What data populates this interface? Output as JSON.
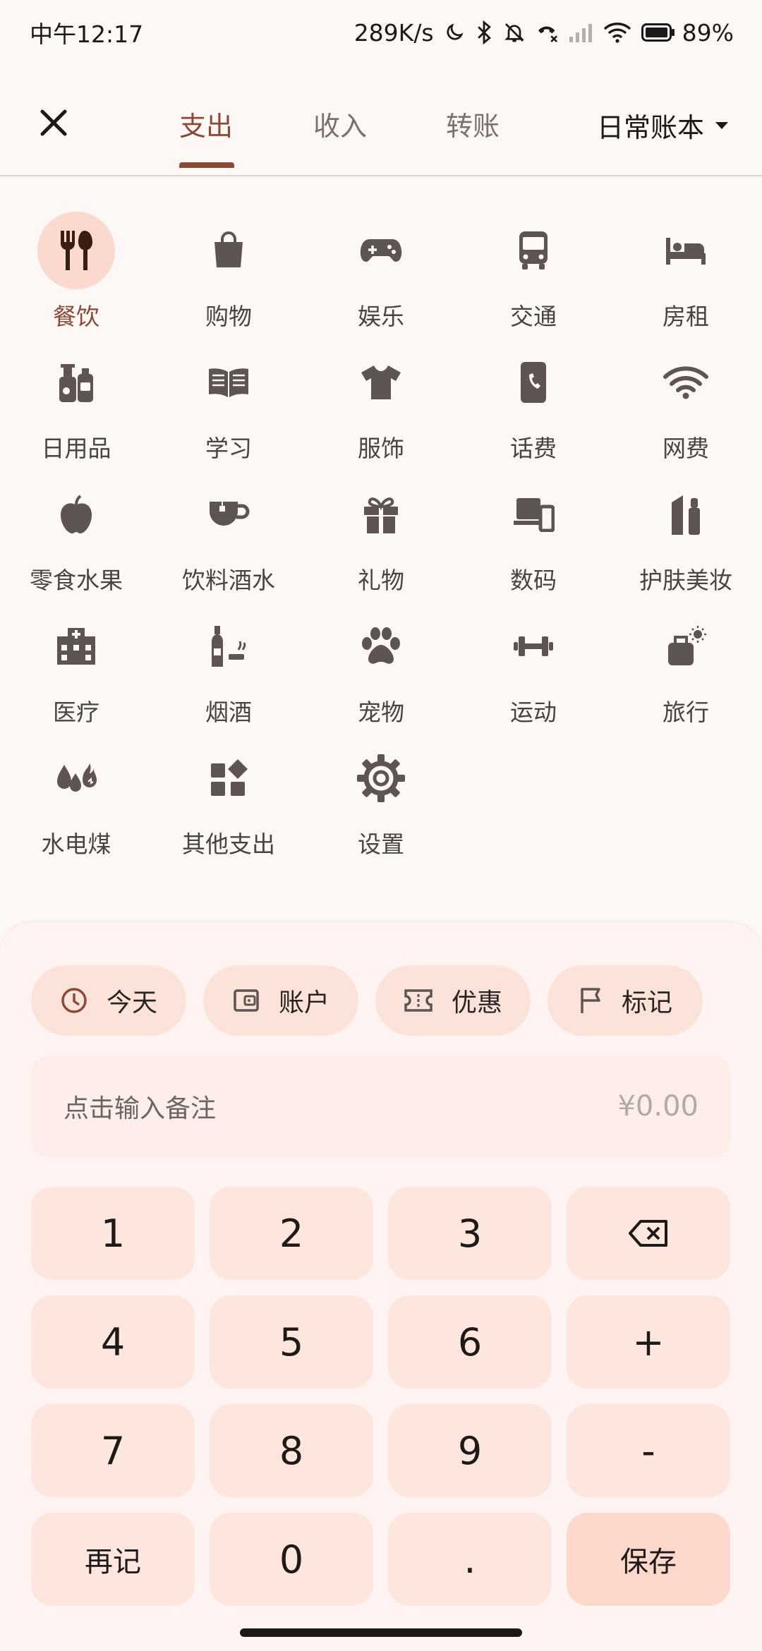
{
  "status_bar": {
    "time": "中午12:17",
    "net_speed": "289K/s",
    "battery": "89%"
  },
  "top_bar": {
    "tabs": [
      {
        "label": "支出",
        "active": true
      },
      {
        "label": "收入",
        "active": false
      },
      {
        "label": "转账",
        "active": false
      }
    ],
    "book": "日常账本"
  },
  "categories": [
    {
      "label": "餐饮",
      "icon": "utensils-icon",
      "selected": true
    },
    {
      "label": "购物",
      "icon": "shopping-bag-icon"
    },
    {
      "label": "娱乐",
      "icon": "gamepad-icon"
    },
    {
      "label": "交通",
      "icon": "bus-icon"
    },
    {
      "label": "房租",
      "icon": "bed-icon"
    },
    {
      "label": "日用品",
      "icon": "toiletries-icon"
    },
    {
      "label": "学习",
      "icon": "book-icon"
    },
    {
      "label": "服饰",
      "icon": "tshirt-icon"
    },
    {
      "label": "话费",
      "icon": "phone-icon"
    },
    {
      "label": "网费",
      "icon": "wifi-icon"
    },
    {
      "label": "零食水果",
      "icon": "apple-icon"
    },
    {
      "label": "饮料酒水",
      "icon": "cup-icon"
    },
    {
      "label": "礼物",
      "icon": "gift-icon"
    },
    {
      "label": "数码",
      "icon": "devices-icon"
    },
    {
      "label": "护肤美妆",
      "icon": "cosmetics-icon"
    },
    {
      "label": "医疗",
      "icon": "hospital-icon"
    },
    {
      "label": "烟酒",
      "icon": "bottle-icon"
    },
    {
      "label": "宠物",
      "icon": "paw-icon"
    },
    {
      "label": "运动",
      "icon": "dumbbell-icon"
    },
    {
      "label": "旅行",
      "icon": "luggage-icon"
    },
    {
      "label": "水电煤",
      "icon": "utilities-icon"
    },
    {
      "label": "其他支出",
      "icon": "widgets-icon"
    },
    {
      "label": "设置",
      "icon": "gear-icon"
    }
  ],
  "chips": [
    {
      "label": "今天",
      "icon": "clock-icon"
    },
    {
      "label": "账户",
      "icon": "wallet-icon"
    },
    {
      "label": "优惠",
      "icon": "ticket-icon"
    },
    {
      "label": "标记",
      "icon": "flag-icon"
    }
  ],
  "note": {
    "placeholder": "点击输入备注",
    "amount": "¥0.00"
  },
  "keypad": [
    "1",
    "2",
    "3",
    "⌫",
    "4",
    "5",
    "6",
    "+",
    "7",
    "8",
    "9",
    "-",
    "再记",
    "0",
    ".",
    "保存"
  ],
  "colors": {
    "accent": "#8a4a36",
    "selected_bg": "#fcd9cf",
    "icon": "#5e5552",
    "key_bg": "#fce6de"
  }
}
